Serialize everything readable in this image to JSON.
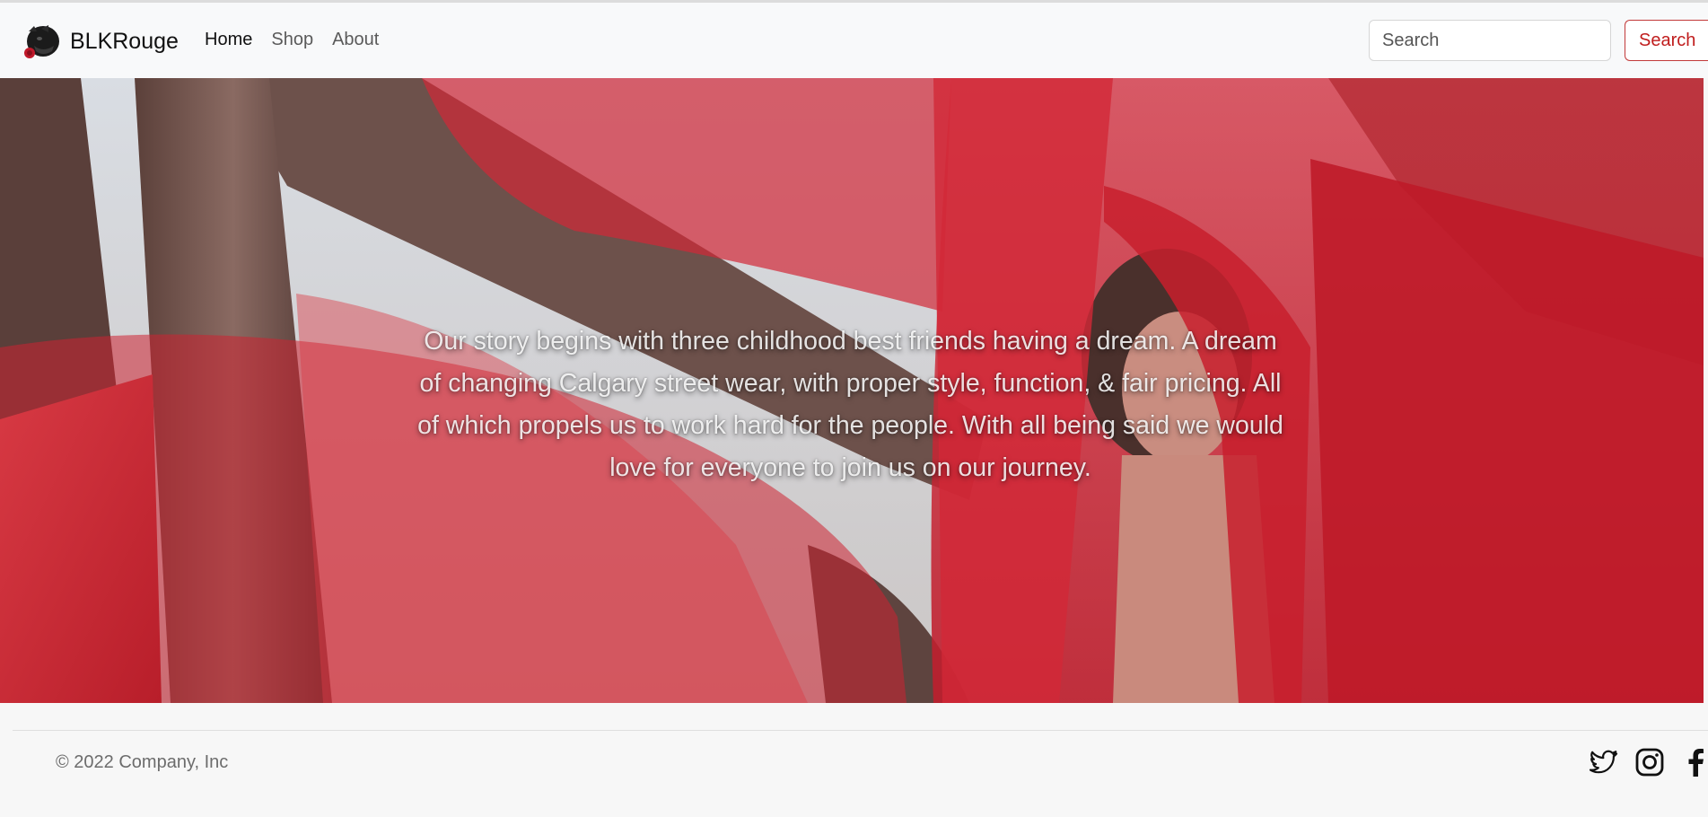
{
  "navbar": {
    "brand": "BLKRouge",
    "links": [
      {
        "label": "Home",
        "active": true
      },
      {
        "label": "Shop",
        "active": false
      },
      {
        "label": "About",
        "active": false
      }
    ],
    "search": {
      "placeholder": "Search",
      "value": "",
      "button_label": "Search"
    }
  },
  "hero": {
    "text": "Our story begins with three childhood best friends having a dream. A dream of changing Calgary street wear, with proper style, function, & fair pricing. All of which propels us to work hard for the people. With all being said we would love for everyone to join us on our journey."
  },
  "footer": {
    "copyright": "© 2022 Company, Inc",
    "social_icons": [
      "twitter-icon",
      "instagram-icon",
      "facebook-icon"
    ]
  },
  "colors": {
    "accent_red": "#c01d1d",
    "navbar_bg": "#f8f9fa",
    "footer_bg": "#f7f7f7"
  }
}
